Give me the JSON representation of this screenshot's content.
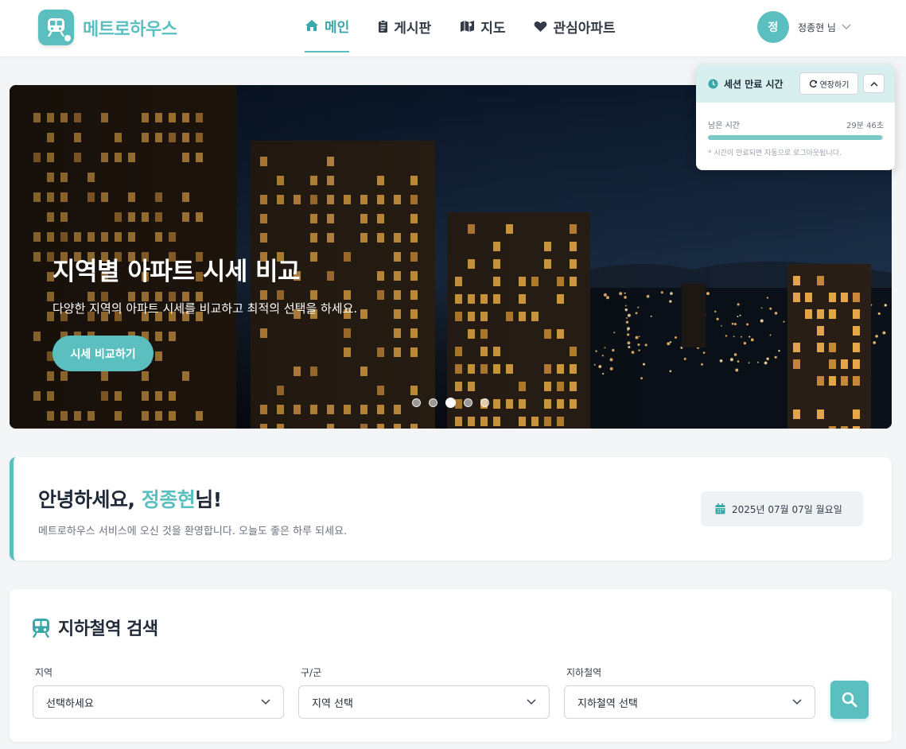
{
  "header": {
    "logo_text": "메트로하우스",
    "nav": [
      {
        "label": "메인",
        "icon": "home-icon",
        "active": true
      },
      {
        "label": "게시판",
        "icon": "clipboard-icon",
        "active": false
      },
      {
        "label": "지도",
        "icon": "map-icon",
        "active": false
      },
      {
        "label": "관심아파트",
        "icon": "heart-icon",
        "active": false
      }
    ],
    "user": {
      "avatar_initial": "정",
      "name": "정종현 님"
    }
  },
  "hero": {
    "title": "지역별 아파트 시세 비교",
    "subtitle": "다양한 지역의 아파트 시세를 비교하고 최적의 선택을 하세요.",
    "button_label": "시세 비교하기",
    "slide_count": 5,
    "active_slide": 3
  },
  "session": {
    "title": "세션 만료 시간",
    "extend_label": "연장하기",
    "remaining_label": "남은 시간",
    "remaining_value": "29분 46초",
    "remaining_fraction": 0.99,
    "note": "* 시간이 만료되면 자동으로 로그아웃됩니다."
  },
  "welcome": {
    "greeting_prefix": "안녕하세요, ",
    "user_name": "정종현",
    "greeting_suffix": "님!",
    "subtitle": "메트로하우스 서비스에 오신 것을 환영합니다. 오늘도 좋은 하루 되세요.",
    "date": "2025년 07월 07일 월요일"
  },
  "search": {
    "title": "지하철역 검색",
    "fields": [
      {
        "label": "지역",
        "value": "선택하세요"
      },
      {
        "label": "구/군",
        "value": "지역 선택"
      },
      {
        "label": "지하철역",
        "value": "지하철역 선택"
      }
    ]
  },
  "colors": {
    "accent": "#5bbfc0",
    "accent_dark": "#3aa7a9",
    "session_header": "#d7f0ef"
  }
}
